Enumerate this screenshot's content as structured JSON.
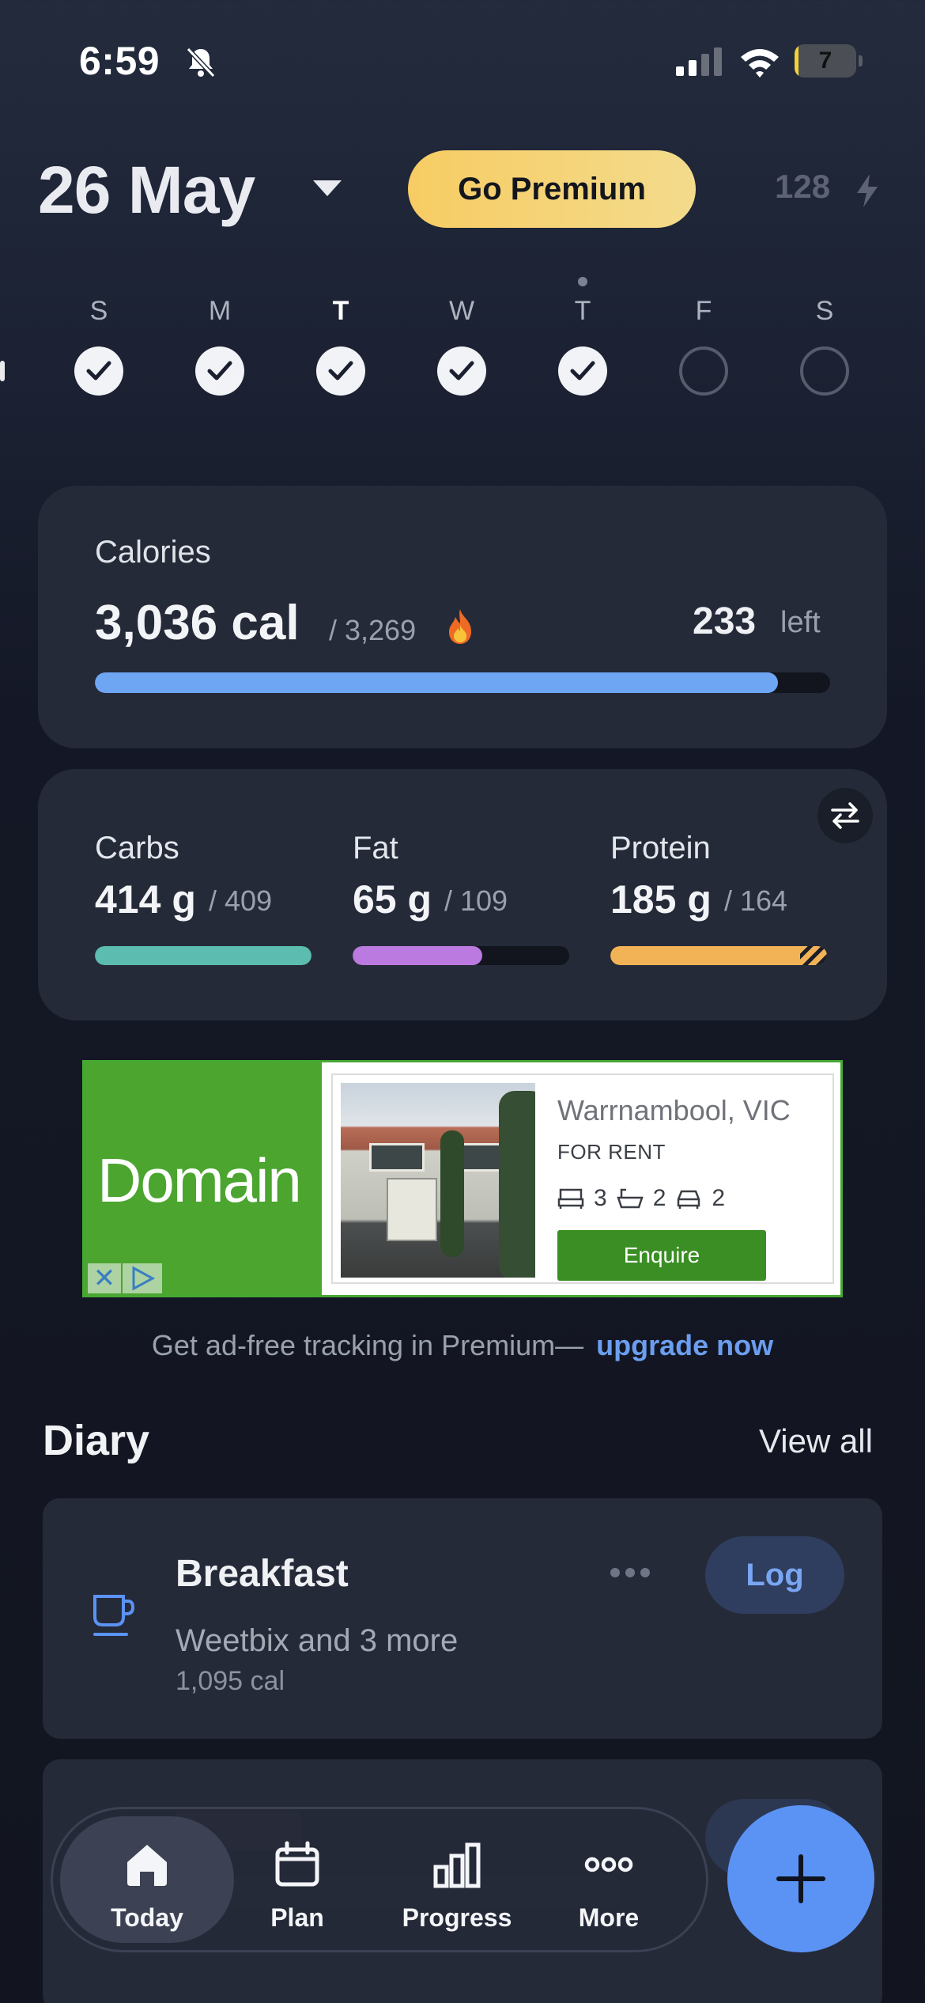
{
  "status_bar": {
    "time": "6:59",
    "battery": "7",
    "battery_fraction": 0.07
  },
  "header": {
    "date": "26 May",
    "premium_label": "Go Premium",
    "streak_count": "128"
  },
  "week": {
    "days": [
      {
        "letter": "S",
        "bold": false,
        "done": true
      },
      {
        "letter": "M",
        "bold": false,
        "done": true
      },
      {
        "letter": "T",
        "bold": true,
        "done": true
      },
      {
        "letter": "W",
        "bold": false,
        "done": true
      },
      {
        "letter": "T",
        "bold": false,
        "done": true,
        "today": true
      },
      {
        "letter": "F",
        "bold": false,
        "done": false
      },
      {
        "letter": "S",
        "bold": false,
        "done": false
      }
    ]
  },
  "calories": {
    "label": "Calories",
    "eaten": "3,036 cal",
    "goal": "/ 3,269",
    "left_value": "233",
    "left_label": "left",
    "progress": 0.929
  },
  "macros": [
    {
      "name": "Carbs",
      "value": "414 g",
      "goal": "/ 409",
      "progress": 1.0,
      "color": "#5bbcaf",
      "over": false
    },
    {
      "name": "Fat",
      "value": "65 g",
      "goal": "/ 109",
      "progress": 0.6,
      "color": "#bb7ae0",
      "over": false
    },
    {
      "name": "Protein",
      "value": "185 g",
      "goal": "/ 164",
      "progress": 1.0,
      "color": "#f2b356",
      "over": true
    }
  ],
  "ad": {
    "brand": "Domain",
    "location": "Warrnambool, VIC",
    "tag": "FOR RENT",
    "beds": "3",
    "baths": "2",
    "cars": "2",
    "cta": "Enquire"
  },
  "upsell": {
    "text": "Get ad-free tracking in Premium—",
    "link": "upgrade now"
  },
  "diary": {
    "title": "Diary",
    "view_all": "View all",
    "meal": {
      "name": "Breakfast",
      "description": "Weetbix and 3 more",
      "calories": "1,095 cal",
      "log_label": "Log"
    }
  },
  "tabbar": {
    "tabs": [
      {
        "label": "Today",
        "icon": "home-icon",
        "active": true
      },
      {
        "label": "Plan",
        "icon": "calendar-icon",
        "active": false
      },
      {
        "label": "Progress",
        "icon": "bar-chart-icon",
        "active": false
      },
      {
        "label": "More",
        "icon": "more-dots-icon",
        "active": false
      }
    ]
  },
  "colors": {
    "accent": "#5b93f5",
    "calorie_bar": "#6fa6f4",
    "premium": "#f7cc63",
    "ad_green": "#4ba52f"
  }
}
